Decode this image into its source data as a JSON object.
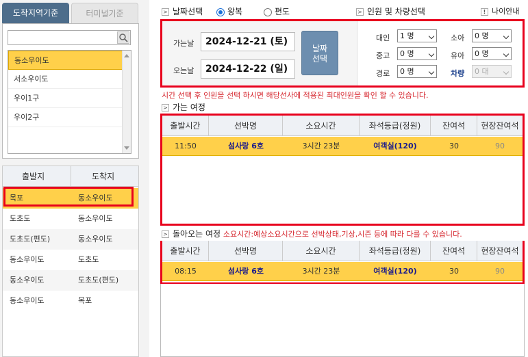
{
  "left": {
    "tabs": [
      {
        "label": "도착지역기준",
        "active": true
      },
      {
        "label": "터미널기준",
        "active": false
      }
    ],
    "search": {
      "value": "",
      "placeholder": ""
    },
    "regions": [
      "동소우이도",
      "서소우이도",
      "우이1구",
      "우이2구"
    ],
    "selected_region": "동소우이도",
    "route_headers": {
      "from": "출발지",
      "to": "도착지"
    },
    "routes": [
      {
        "from": "목포",
        "to": "동소우이도",
        "selected": true
      },
      {
        "from": "도초도",
        "to": "동소우이도",
        "selected": false
      },
      {
        "from": "도초도(편도)",
        "to": "동소우이도",
        "selected": false
      },
      {
        "from": "동소우이도",
        "to": "도초도",
        "selected": false
      },
      {
        "from": "동소우이도",
        "to": "도초도(편도)",
        "selected": false
      },
      {
        "from": "동소우이도",
        "to": "목포",
        "selected": false
      }
    ]
  },
  "date_section": {
    "title": "날짜선택",
    "radio_roundtrip": "왕복",
    "radio_oneway": "편도",
    "selected": "왕복",
    "depart_label": "가는날",
    "depart_value": "2024-12-21 (토)",
    "return_label": "오는날",
    "return_value": "2024-12-22 (일)",
    "select_button_line1": "날짜",
    "select_button_line2": "선택"
  },
  "pax_section": {
    "title": "인원 및 차량선택",
    "age_guide": "나이안내",
    "fields": {
      "adult": {
        "label": "대인",
        "value": "1 명"
      },
      "child": {
        "label": "소아",
        "value": "0 명"
      },
      "youth": {
        "label": "중고",
        "value": "0 명"
      },
      "infant": {
        "label": "유아",
        "value": "0 명"
      },
      "senior": {
        "label": "경로",
        "value": "0 명"
      },
      "vehicle": {
        "label": "차량",
        "value": "0 대",
        "disabled": true
      }
    }
  },
  "notice": "시간 선택 후 인원을 선택 하시면 해당선사에 적용된 최대인원을 확인 할 수 있습니다.",
  "outbound": {
    "title": "가는 여정",
    "headers": [
      "출발시간",
      "선박명",
      "소요시간",
      "좌석등급(정원)",
      "잔여석",
      "현장잔여석"
    ],
    "rows": [
      {
        "time": "11:50",
        "ship": "섬사랑 6호",
        "duration": "3시간 23분",
        "grade": "여객실(120)",
        "remaining": "30",
        "onsite": "90"
      }
    ]
  },
  "return": {
    "title": "돌아오는 여정",
    "note": "소요시간:예상소요시간으로 선박상태,기상,시즌 등에 따라 다를 수 있습니다.",
    "headers": [
      "출발시간",
      "선박명",
      "소요시간",
      "좌석등급(정원)",
      "잔여석",
      "현장잔여석"
    ],
    "rows": [
      {
        "time": "08:15",
        "ship": "섬사랑 6호",
        "duration": "3시간 23분",
        "grade": "여객실(120)",
        "remaining": "30",
        "onsite": "90"
      }
    ]
  },
  "colors": {
    "highlight": "#ffd04a",
    "annotation_red": "#e8001c",
    "tab_active": "#4d6d8b",
    "button": "#6d8eaf",
    "notice_red": "#d6262e"
  }
}
